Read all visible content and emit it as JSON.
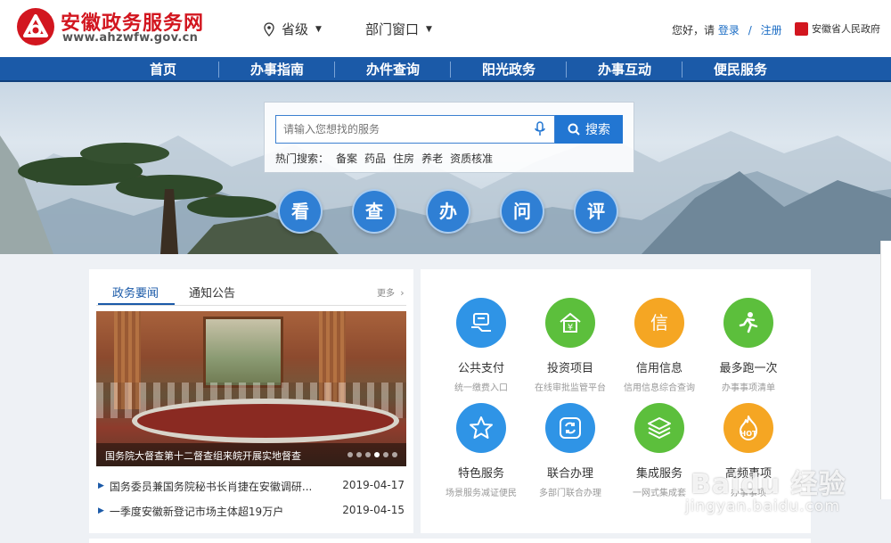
{
  "header": {
    "site_title": "安徽政务服务网",
    "site_url": "www.ahzwfw.gov.cn",
    "region": "省级",
    "department": "部门窗口",
    "greeting": "您好，请",
    "login": "登录",
    "separator": "/",
    "register": "注册",
    "gov_link": "安徽省人民政府"
  },
  "nav": {
    "items": [
      "首页",
      "办事指南",
      "办件查询",
      "阳光政务",
      "办事互动",
      "便民服务"
    ]
  },
  "banner": {
    "search_placeholder": "请输入您想找的服务",
    "search_button": "搜索",
    "hot_label": "热门搜索：",
    "hot_keywords": [
      "备案",
      "药品",
      "住房",
      "养老",
      "资质核准"
    ],
    "quick_actions": [
      "看",
      "查",
      "办",
      "问",
      "评"
    ]
  },
  "news": {
    "tabs": [
      "政务要闻",
      "通知公告"
    ],
    "active_tab": "政务要闻",
    "more": "更多",
    "slide_caption": "国务院大督查第十二督查组来皖开展实地督查",
    "slide_count": 6,
    "active_slide": 3,
    "items": [
      {
        "title": "国务委员兼国务院秘书长肖捷在安徽调研...",
        "date": "2019-04-17"
      },
      {
        "title": "一季度安徽新登记市场主体超19万户",
        "date": "2019-04-15"
      }
    ]
  },
  "services": {
    "items": [
      {
        "name": "公共支付",
        "sub": "统一缴费入口",
        "icon": "payment-icon",
        "color": "#2f94e6"
      },
      {
        "name": "投资项目",
        "sub": "在线审批监管平台",
        "icon": "house-yen-icon",
        "color": "#5cbf3c"
      },
      {
        "name": "信用信息",
        "sub": "信用信息综合查询",
        "icon": "credit-icon",
        "color": "#f5a623"
      },
      {
        "name": "最多跑一次",
        "sub": "办事事项清单",
        "icon": "runner-icon",
        "color": "#5cbf3c"
      },
      {
        "name": "特色服务",
        "sub": "场景服务减证便民",
        "icon": "star-icon",
        "color": "#2f94e6"
      },
      {
        "name": "联合办理",
        "sub": "多部门联合办理",
        "icon": "sync-icon",
        "color": "#2f94e6"
      },
      {
        "name": "集成服务",
        "sub": "一网式集成套",
        "icon": "layers-icon",
        "color": "#5cbf3c"
      },
      {
        "name": "高频事项",
        "sub": "办事事项",
        "icon": "hot-flame-icon",
        "color": "#f5a623",
        "badge": "HOT"
      }
    ]
  },
  "watermark": {
    "main": "Baidu 经验",
    "sub": "jingyan.baidu.com"
  },
  "colors": {
    "brand_red": "#d2161f",
    "nav_blue": "#1b5aa8",
    "link_blue": "#1a6cc4"
  }
}
